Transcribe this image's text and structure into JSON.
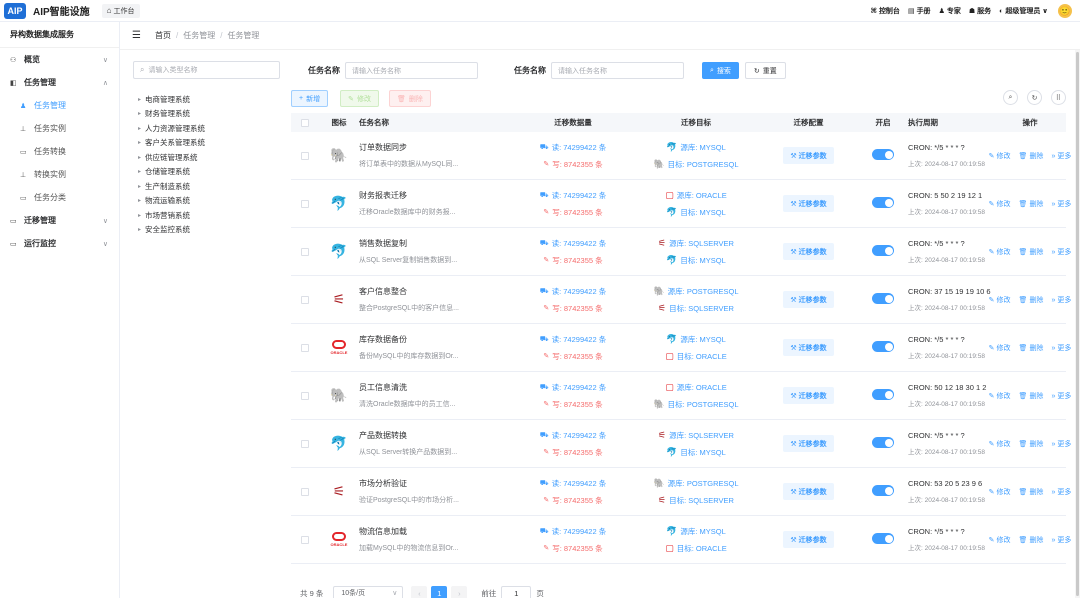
{
  "app": {
    "logo": "AIP",
    "title": "AIP智能设施",
    "tab": "工作台"
  },
  "topnav": [
    {
      "icon": "dashboard-icon",
      "glyph": "⌘",
      "label": "控制台"
    },
    {
      "icon": "manual-icon",
      "glyph": "▤",
      "label": "手册"
    },
    {
      "icon": "expert-icon",
      "glyph": "♟",
      "label": "专家"
    },
    {
      "icon": "service-icon",
      "glyph": "☗",
      "label": "服务"
    },
    {
      "icon": "admin-icon",
      "glyph": "◐",
      "label": "超级管理员 ∨"
    }
  ],
  "sidebar": {
    "header": "异构数据集成服务",
    "items": [
      {
        "label": "概览",
        "glyph": "⚇",
        "chev": "∨"
      },
      {
        "label": "任务管理",
        "glyph": "◧",
        "chev": "∧"
      }
    ],
    "subitems": [
      {
        "label": "任务管理",
        "glyph": "♟"
      },
      {
        "label": "任务实例",
        "glyph": "⊥"
      },
      {
        "label": "任务转换",
        "glyph": "▭"
      },
      {
        "label": "转换实例",
        "glyph": "⊥"
      },
      {
        "label": "任务分类",
        "glyph": "▭"
      }
    ],
    "items2": [
      {
        "label": "迁移管理",
        "glyph": "▭",
        "chev": "∨"
      },
      {
        "label": "运行监控",
        "glyph": "▭",
        "chev": "∨"
      }
    ]
  },
  "breadcrumb": [
    "首页",
    "任务管理",
    "任务管理"
  ],
  "tree": {
    "placeholder": "请输入类型名称",
    "nodes": [
      "电商管理系统",
      "财务管理系统",
      "人力资源管理系统",
      "客户关系管理系统",
      "供应链管理系统",
      "仓储管理系统",
      "生产制造系统",
      "物流运输系统",
      "市场营销系统",
      "安全监控系统"
    ]
  },
  "filters": {
    "label1": "任务名称",
    "placeholder1": "请输入任务名称",
    "label2": "任务名称",
    "placeholder2": "请输入任务名称",
    "search": "搜索",
    "reset": "重置"
  },
  "actions": {
    "add": "新增",
    "edit": "修改",
    "delete": "删除"
  },
  "table": {
    "headers": [
      "图标",
      "任务名称",
      "迁移数据量",
      "迁移目标",
      "迁移配置",
      "开启",
      "执行周期",
      "操作"
    ],
    "param_label": "迁移参数",
    "op_edit": "修改",
    "op_delete": "删除",
    "op_more": "更多",
    "rows": [
      {
        "icon": "pg",
        "name": "订单数据同步",
        "desc": "将订单表中的数据从MySQL同...",
        "read": "读: 74299422 条",
        "write": "写: 8742355 条",
        "src_icon": "mysql",
        "src": "源库: MYSQL",
        "dst_icon": "pg",
        "dst": "目标: POSTGRESQL",
        "cron": "CRON: */5 * * * ?",
        "last": "上次: 2024-08-17 00:19:58"
      },
      {
        "icon": "mysql",
        "name": "财务报表迁移",
        "desc": "迁移Oracle数据库中的财务报...",
        "read": "读: 74299422 条",
        "write": "写: 8742355 条",
        "src_icon": "oracle",
        "src": "源库: ORACLE",
        "dst_icon": "mysql",
        "dst": "目标: MYSQL",
        "cron": "CRON: 5 50 2 19 12 1",
        "last": "上次: 2024-08-17 00:19:58"
      },
      {
        "icon": "mysql",
        "name": "销售数据复制",
        "desc": "从SQL Server复制销售数据到...",
        "read": "读: 74299422 条",
        "write": "写: 8742355 条",
        "src_icon": "mssql",
        "src": "源库: SQLSERVER",
        "dst_icon": "mysql",
        "dst": "目标: MYSQL",
        "cron": "CRON: */5 * * * ?",
        "last": "上次: 2024-08-17 00:19:58"
      },
      {
        "icon": "mssql",
        "name": "客户信息整合",
        "desc": "整合PostgreSQL中的客户信息...",
        "read": "读: 74299422 条",
        "write": "写: 8742355 条",
        "src_icon": "pg",
        "src": "源库: POSTGRESQL",
        "dst_icon": "mssql",
        "dst": "目标: SQLSERVER",
        "cron": "CRON: 37 15 19 19 10 6",
        "last": "上次: 2024-08-17 00:19:58"
      },
      {
        "icon": "oracle",
        "name": "库存数据备份",
        "desc": "备份MySQL中的库存数据到Or...",
        "read": "读: 74299422 条",
        "write": "写: 8742355 条",
        "src_icon": "mysql",
        "src": "源库: MYSQL",
        "dst_icon": "oracle",
        "dst": "目标: ORACLE",
        "cron": "CRON: */5 * * * ?",
        "last": "上次: 2024-08-17 00:19:58"
      },
      {
        "icon": "pg",
        "name": "员工信息清洗",
        "desc": "清洗Oracle数据库中的员工信...",
        "read": "读: 74299422 条",
        "write": "写: 8742355 条",
        "src_icon": "oracle",
        "src": "源库: ORACLE",
        "dst_icon": "pg",
        "dst": "目标: POSTGRESQL",
        "cron": "CRON: 50 12 18 30 1 2",
        "last": "上次: 2024-08-17 00:19:58"
      },
      {
        "icon": "mysql",
        "name": "产品数据转换",
        "desc": "从SQL Server转换产品数据到...",
        "read": "读: 74299422 条",
        "write": "写: 8742355 条",
        "src_icon": "mssql",
        "src": "源库: SQLSERVER",
        "dst_icon": "mysql",
        "dst": "目标: MYSQL",
        "cron": "CRON: */5 * * * ?",
        "last": "上次: 2024-08-17 00:19:58"
      },
      {
        "icon": "mssql",
        "name": "市场分析验证",
        "desc": "验证PostgreSQL中的市场分析...",
        "read": "读: 74299422 条",
        "write": "写: 8742355 条",
        "src_icon": "pg",
        "src": "源库: POSTGRESQL",
        "dst_icon": "mssql",
        "dst": "目标: SQLSERVER",
        "cron": "CRON: 53 20 5 23 9 6",
        "last": "上次: 2024-08-17 00:19:58"
      },
      {
        "icon": "oracle",
        "name": "物流信息加载",
        "desc": "加载MySQL中的物流信息到Or...",
        "read": "读: 74299422 条",
        "write": "写: 8742355 条",
        "src_icon": "mysql",
        "src": "源库: MYSQL",
        "dst_icon": "oracle",
        "dst": "目标: ORACLE",
        "cron": "CRON: */5 * * * ?",
        "last": "上次: 2024-08-17 00:19:58"
      }
    ]
  },
  "pager": {
    "total": "共 9 条",
    "size": "10条/页",
    "current": "1",
    "goto": "前往",
    "goto_value": "1",
    "page": "页"
  },
  "colors": {
    "primary": "#409eff",
    "danger": "#f56c6c",
    "pg": "#336791",
    "mysql": "#4479a1",
    "mssql": "#a91d22",
    "oracle": "#e3262b"
  },
  "db_glyphs": {
    "pg": "🐘",
    "mysql": "🐬",
    "mssql": "⚟"
  }
}
